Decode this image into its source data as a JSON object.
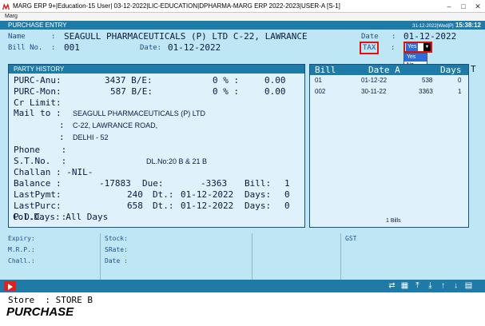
{
  "window": {
    "title": "MARG ERP 9+|Education-15 User| 03-12-2022|LIC-EDUCATION|DPHARMA-MARG ERP 2022-2023|USER-A [S-1]",
    "menu": "Marg"
  },
  "header": {
    "title": "PURCHASE ENTRY",
    "datetime": "31-12-2022|Wed|P|",
    "clock": "15:38:12"
  },
  "form": {
    "name_label": "Name",
    "name_sep": ":",
    "name_value": "SEAGULL PHARMACEUTICALS (P) LTD C-22, LAWRANCE",
    "date_label": "Date",
    "date_sep": ":",
    "date_value": "01-12-2022",
    "bill_no_label": "Bill No.",
    "bill_no_sep": ":",
    "bill_no_value": "001",
    "bill_date_label": "Date:",
    "bill_date_value": "01-12-2022",
    "tax_label": "TAX",
    "tax_sep": ":",
    "tax_value": "Yes",
    "tax_options": [
      "Yes",
      "No"
    ]
  },
  "party_history": {
    "title": "PARTY HISTORY",
    "purc_anu": {
      "label": "PURC-Anu:",
      "amount": "3437 B/E:",
      "pct": "0 % :",
      "value": "0.00"
    },
    "purc_mon": {
      "label": "PURC-Mon:",
      "amount": "587 B/E:",
      "pct": "0 % :",
      "value": "0.00"
    },
    "cr_limit": "Cr Limit:",
    "mail_to_label": "Mail to :",
    "address": [
      "SEAGULL PHARMACEUTICALS (P) LTD",
      "C-22, LAWRANCE ROAD,",
      "DELHI - 52"
    ],
    "colon": ":",
    "phone_label": "Phone    :",
    "stno_label": "S.T.No.  :",
    "dl_no": "DL.No:20 B & 21 B",
    "challan": "Challan : -NIL-",
    "balance": {
      "label": "Balance :",
      "amount": "-17883",
      "due_label": "Due:",
      "due": "-3363",
      "bill_label": "Bill:",
      "bill": "1"
    },
    "lastpymt": {
      "label": "LastPymt:",
      "amount": "240",
      "dt_label": "Dt.:",
      "dt": "01-12-2022",
      "days_label": "Days:",
      "days": "0"
    },
    "lastpurc": {
      "label": "LastPurc:",
      "amount": "658",
      "dt_label": "Dt.:",
      "dt": "01-12-2022",
      "days_label": "Days:",
      "days": "0"
    },
    "pdc": "P.D.C.   :",
    "col_days": "Col.Days: All Days"
  },
  "bills": {
    "columns": [
      "Bill",
      "Date A",
      "Days"
    ],
    "overflow_col": "T",
    "rows": [
      {
        "bill": "01",
        "date": "01-12-22",
        "amount": "538",
        "days": "0"
      },
      {
        "bill": "002",
        "date": "30-11-22",
        "amount": "3363",
        "days": "1"
      }
    ],
    "summary": "1 Bills"
  },
  "bottom_grid": {
    "expiry": "Expiry:",
    "stock": "Stock:",
    "gst": "GST",
    "mrp": "M.R.P.:",
    "srate": "SRate:",
    "chall": "Chall.:",
    "date": "Date :"
  },
  "footer": {
    "store": "Store  : STORE B",
    "mode": "PURCHASE"
  },
  "toolbar": {
    "icons": [
      "shuffle-icon",
      "calculator-icon",
      "align-top-icon",
      "align-bottom-icon",
      "arrow-up-icon",
      "arrow-down-icon",
      "grid-icon"
    ]
  },
  "colors": {
    "background": "#bfe6f5",
    "header_bar": "#1e7ba8",
    "highlight": "#e01010",
    "selection": "#2a6edb"
  }
}
